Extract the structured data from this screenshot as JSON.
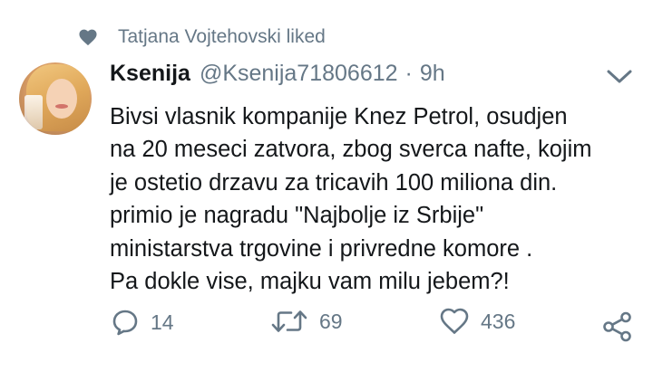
{
  "social_context": {
    "text": "Tatjana Vojtehovski liked"
  },
  "tweet": {
    "author_name": "Ksenija",
    "handle": "@Ksenija71806612",
    "separator": "·",
    "time": "9h",
    "text_lines": [
      "Bivsi vlasnik kompanije Knez Petrol, osudjen",
      "na 20 meseci zatvora, zbog sverca nafte, kojim",
      "je ostetio drzavu za tricavih 100 miliona din.",
      "primio je nagradu \"Najbolje iz Srbije\"",
      "ministarstva trgovine i privredne komore .",
      "Pa dokle vise, majku vam milu jebem?!"
    ]
  },
  "actions": {
    "reply_count": "14",
    "retweet_count": "69",
    "like_count": "436"
  },
  "icons": [
    "heart-icon",
    "chevron-down-icon",
    "reply-icon",
    "retweet-icon",
    "like-icon",
    "share-icon"
  ],
  "colors": {
    "text": "#14171a",
    "muted": "#657786",
    "background": "#ffffff"
  }
}
